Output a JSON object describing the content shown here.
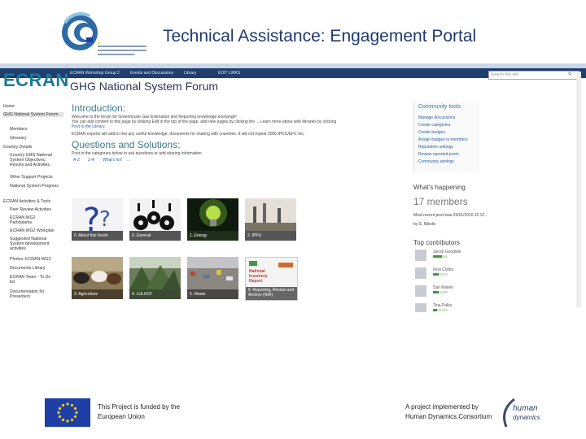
{
  "slide_title": "Technical Assistance: Engagement Portal",
  "colors": {
    "ecran": "#1c7a9a",
    "topnav": "#1e3f6e",
    "heading": "#3a7a84",
    "eu_blue": "#1f3fa6",
    "gold": "#f5d000"
  },
  "topnav": {
    "site": "ECRAN Workshop Group 2",
    "items": [
      "Events and Discussions",
      "Library",
      "EDIT LINKS"
    ]
  },
  "brand": "ECRAN",
  "page": {
    "crumb": "ECRAN Workshop Group 2",
    "title": "GHG National System Forum",
    "search_placeholder": "Search this site"
  },
  "leftnav": [
    "Home",
    "GHG National System Forum",
    "Members",
    "Glossary",
    "Country Details",
    "Country GHG National System Objectives, Results and Activities",
    "Other Support Projects",
    "National System Progress",
    "ECRAN Activities & Tools",
    "Peer Review Activities",
    "ECRAN WG2 Participants",
    "ECRAN WG2 Workplan",
    "Suggested National System development activities",
    "Photos: ECRAN WG2",
    "Documents Library",
    "ECRAN Team - To Do list",
    "Documentation for Presenters"
  ],
  "intro": {
    "heading": "Introduction:",
    "lines": [
      "Welcome to the forum for Greenhouse Gas Estimation and Reporting knowledge exchange!",
      "You can add content to this page by clicking Edit in the top of the page, add new pages by clicking the ... Learn more about web libraries by clicking",
      "Post to the Library."
    ],
    "experts": "ECRAN experts will add to this any useful knowledge, documents for sharing with countries. It will not repeat 2006 IPCC/EFC etc."
  },
  "qa": {
    "heading": "Questions and Solutions:",
    "line": "Post in the categories below to ask questions or add sharing information.",
    "sort": [
      "A-Z",
      "Z-A",
      "What's hot",
      "..."
    ]
  },
  "tiles": [
    {
      "label": "0. About this forum",
      "icon": "question-mark-icon"
    },
    {
      "label": "0. General",
      "icon": "gears-people-icon"
    },
    {
      "label": "1. Energy",
      "icon": "lightbulb-icon"
    },
    {
      "label": "2. IPPU",
      "icon": "factory-icon"
    },
    {
      "label": "3. Agriculture",
      "icon": "cows-icon"
    },
    {
      "label": "4. LULUCF",
      "icon": "forest-icon"
    },
    {
      "label": "5. Waste",
      "icon": "landfill-icon"
    },
    {
      "label": "6. Reporting, Review and Archive (NIR)",
      "icon": "report-cover-icon"
    }
  ],
  "nir_cover": "National Inventory Report",
  "community": {
    "heading": "Community tools",
    "items": [
      "Manage discussions",
      "Create categories",
      "Create badges",
      "Assign badges to members",
      "Reputation settings",
      "Review reported posts",
      "Community settings"
    ]
  },
  "happening": {
    "heading": "What's happening",
    "members": "17 members",
    "latest": "Most recent post was 29/01/2015 11:12...",
    "by": "by S. Nikolic"
  },
  "top": {
    "heading": "Top contributors",
    "people": [
      {
        "name": "Jacob Goodwin",
        "level": 0.6
      },
      {
        "name": "Irina Collos",
        "level": 0.4
      },
      {
        "name": "Sari Maleki",
        "level": 0.4
      },
      {
        "name": "Tina Palko",
        "level": 0.3
      }
    ]
  },
  "footer": {
    "eu_line1": "This Project is funded by the",
    "eu_line2": "European Union",
    "hd_line1": "A project implemented by",
    "hd_line2": "Human Dynamics Consortium",
    "hd_logo_word1": "human",
    "hd_logo_word2": "dynamics"
  }
}
